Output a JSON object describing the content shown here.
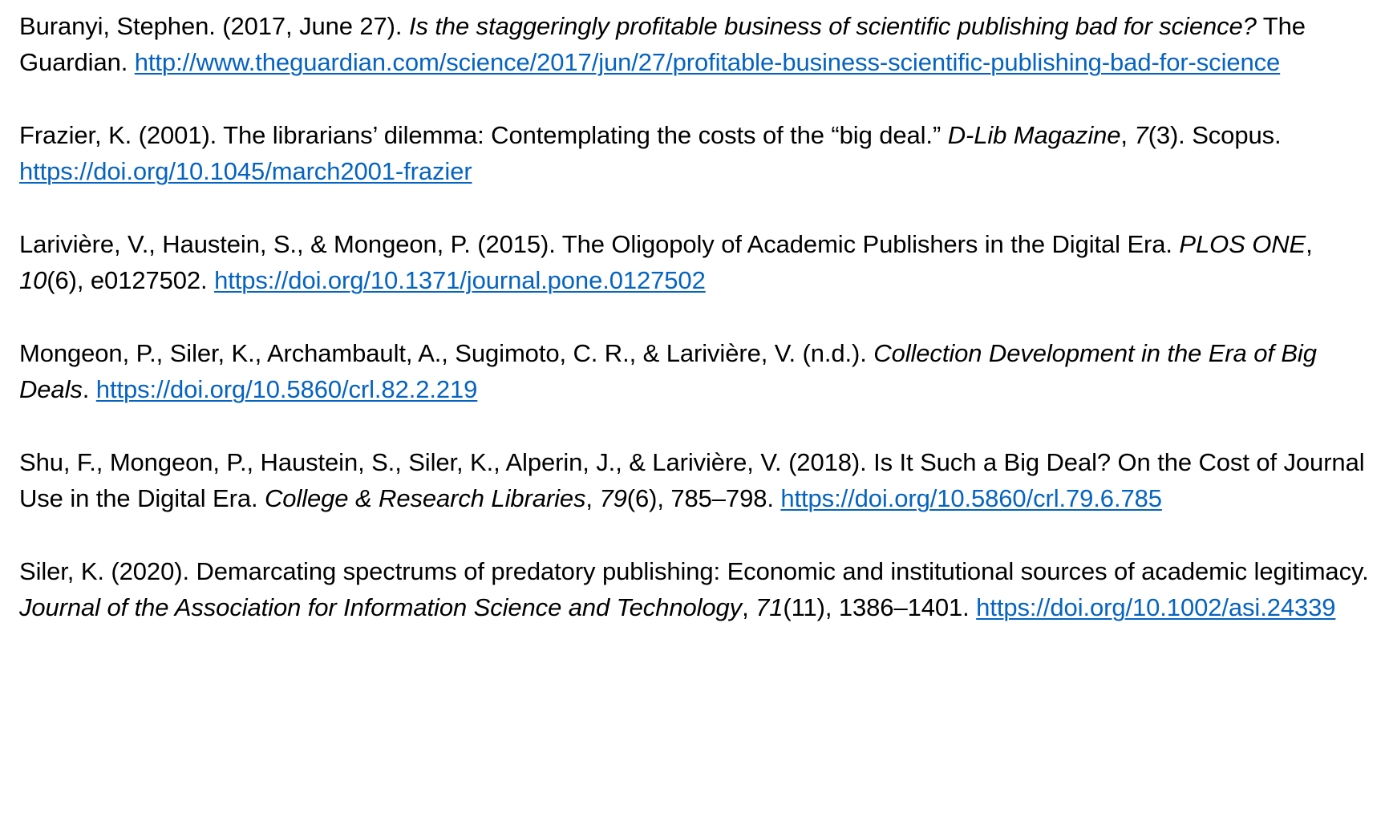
{
  "references": [
    {
      "text_1": "Buranyi, Stephen. (2017, June 27). ",
      "title_italic": "Is the staggeringly profitable business of scientific publishing bad for science?",
      "text_2": " The Guardian. ",
      "link": "http://www.theguardian.com/science/2017/jun/27/profitable-business-scientific-publishing-bad-for-science"
    },
    {
      "text_1": "Frazier, K. (2001). The librarians’ dilemma: Contemplating the costs of the “big deal.” ",
      "journal_italic": "D-Lib Magazine",
      "sep": ", ",
      "volume_italic": "7",
      "text_2": "(3). Scopus. ",
      "link": "https://doi.org/10.1045/march2001-frazier"
    },
    {
      "text_1": "Larivière, V., Haustein, S., & Mongeon, P. (2015). The Oligopoly of Academic Publishers in the Digital Era. ",
      "journal_italic": "PLOS ONE",
      "sep": ", ",
      "volume_italic": "10",
      "text_2": "(6), e0127502. ",
      "link": "https://doi.org/10.1371/journal.pone.0127502"
    },
    {
      "text_1": "Mongeon, P., Siler, K., Archambault, A., Sugimoto, C. R., & Larivière, V. (n.d.). ",
      "title_italic": "Collection Development in the Era of Big Deals",
      "text_2": ". ",
      "link": "https://doi.org/10.5860/crl.82.2.219"
    },
    {
      "text_1": "Shu, F., Mongeon, P., Haustein, S., Siler, K., Alperin, J., & Larivière, V. (2018). Is It Such a Big Deal? On the Cost of Journal Use in the Digital Era. ",
      "journal_italic": "College & Research Libraries",
      "sep": ", ",
      "volume_italic": "79",
      "text_2": "(6), 785–798. ",
      "link": "https://doi.org/10.5860/crl.79.6.785"
    },
    {
      "text_1": "Siler, K. (2020). Demarcating spectrums of predatory publishing: Economic and institutional sources of academic legitimacy. ",
      "journal_italic": "Journal of the Association for Information Science and Technology",
      "sep": ", ",
      "volume_italic": "71",
      "text_2": "(11), 1386–1401. ",
      "link": "https://doi.org/10.1002/asi.24339"
    }
  ],
  "colors": {
    "text": "#000000",
    "link": "#0563c1",
    "background": "#ffffff"
  }
}
